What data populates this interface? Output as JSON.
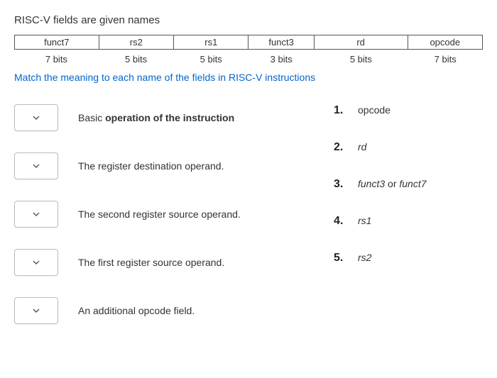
{
  "title": "RISC-V fields are given names",
  "fields": {
    "names": [
      "funct7",
      "rs2",
      "rs1",
      "funct3",
      "rd",
      "opcode"
    ],
    "bits": [
      "7 bits",
      "5 bits",
      "5 bits",
      "3 bits",
      "5 bits",
      "7 bits"
    ]
  },
  "instructions": "Match the meaning to each name of the fields in RISC-V instructions",
  "matches": [
    {
      "prefix": "Basic ",
      "bold": "operation of the instruction"
    },
    {
      "text": "The register destination operand."
    },
    {
      "text": "The second register source operand."
    },
    {
      "text": "The first register source operand."
    },
    {
      "text": "An additional opcode field."
    }
  ],
  "options": [
    {
      "num": "1.",
      "text": "opcode",
      "italic": false
    },
    {
      "num": "2.",
      "text": "rd",
      "italic": true
    },
    {
      "num": "3.",
      "text": "funct3 or funct7",
      "italic": true,
      "mixed": true
    },
    {
      "num": "4.",
      "text": "rs1",
      "italic": true
    },
    {
      "num": "5.",
      "text": "rs2",
      "italic": true
    }
  ]
}
